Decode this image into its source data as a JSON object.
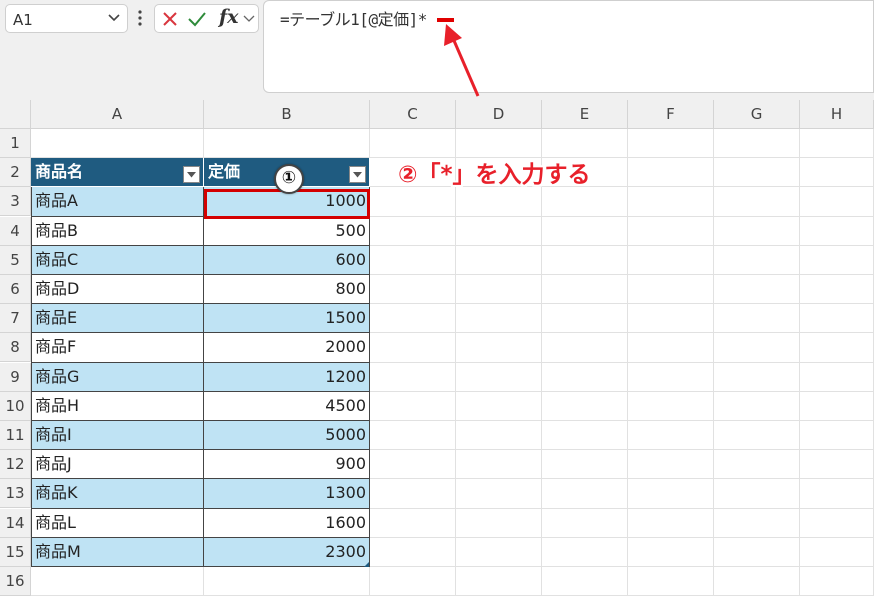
{
  "name_box": {
    "value": "A1"
  },
  "formula_bar": {
    "text": "=テーブル1[@定価]*"
  },
  "columns": [
    "A",
    "B",
    "C",
    "D",
    "E",
    "F",
    "G",
    "H"
  ],
  "rows": [
    "1",
    "2",
    "3",
    "4",
    "5",
    "6",
    "7",
    "8",
    "9",
    "10",
    "11",
    "12",
    "13",
    "14",
    "15",
    "16"
  ],
  "table": {
    "headers": [
      "商品名",
      "定価"
    ],
    "rows": [
      {
        "name": "商品A",
        "price": "1000"
      },
      {
        "name": "商品B",
        "price": "500"
      },
      {
        "name": "商品C",
        "price": "600"
      },
      {
        "name": "商品D",
        "price": "800"
      },
      {
        "name": "商品E",
        "price": "1500"
      },
      {
        "name": "商品F",
        "price": "2000"
      },
      {
        "name": "商品G",
        "price": "1200"
      },
      {
        "name": "商品H",
        "price": "4500"
      },
      {
        "name": "商品I",
        "price": "5000"
      },
      {
        "name": "商品J",
        "price": "900"
      },
      {
        "name": "商品K",
        "price": "1300"
      },
      {
        "name": "商品L",
        "price": "1600"
      },
      {
        "name": "商品M",
        "price": "2300"
      }
    ]
  },
  "annotations": {
    "badge_1": "①",
    "step_2": "②「*」を入力する"
  },
  "colors": {
    "table_header": "#1f5b80",
    "band": "#bfe3f4",
    "highlight_red": "#d40000"
  },
  "icons": [
    "chevron-down-icon",
    "more-vertical-icon",
    "cancel-icon",
    "enter-check-icon",
    "fx-icon",
    "filter-dropdown-icon",
    "arrow-icon"
  ]
}
